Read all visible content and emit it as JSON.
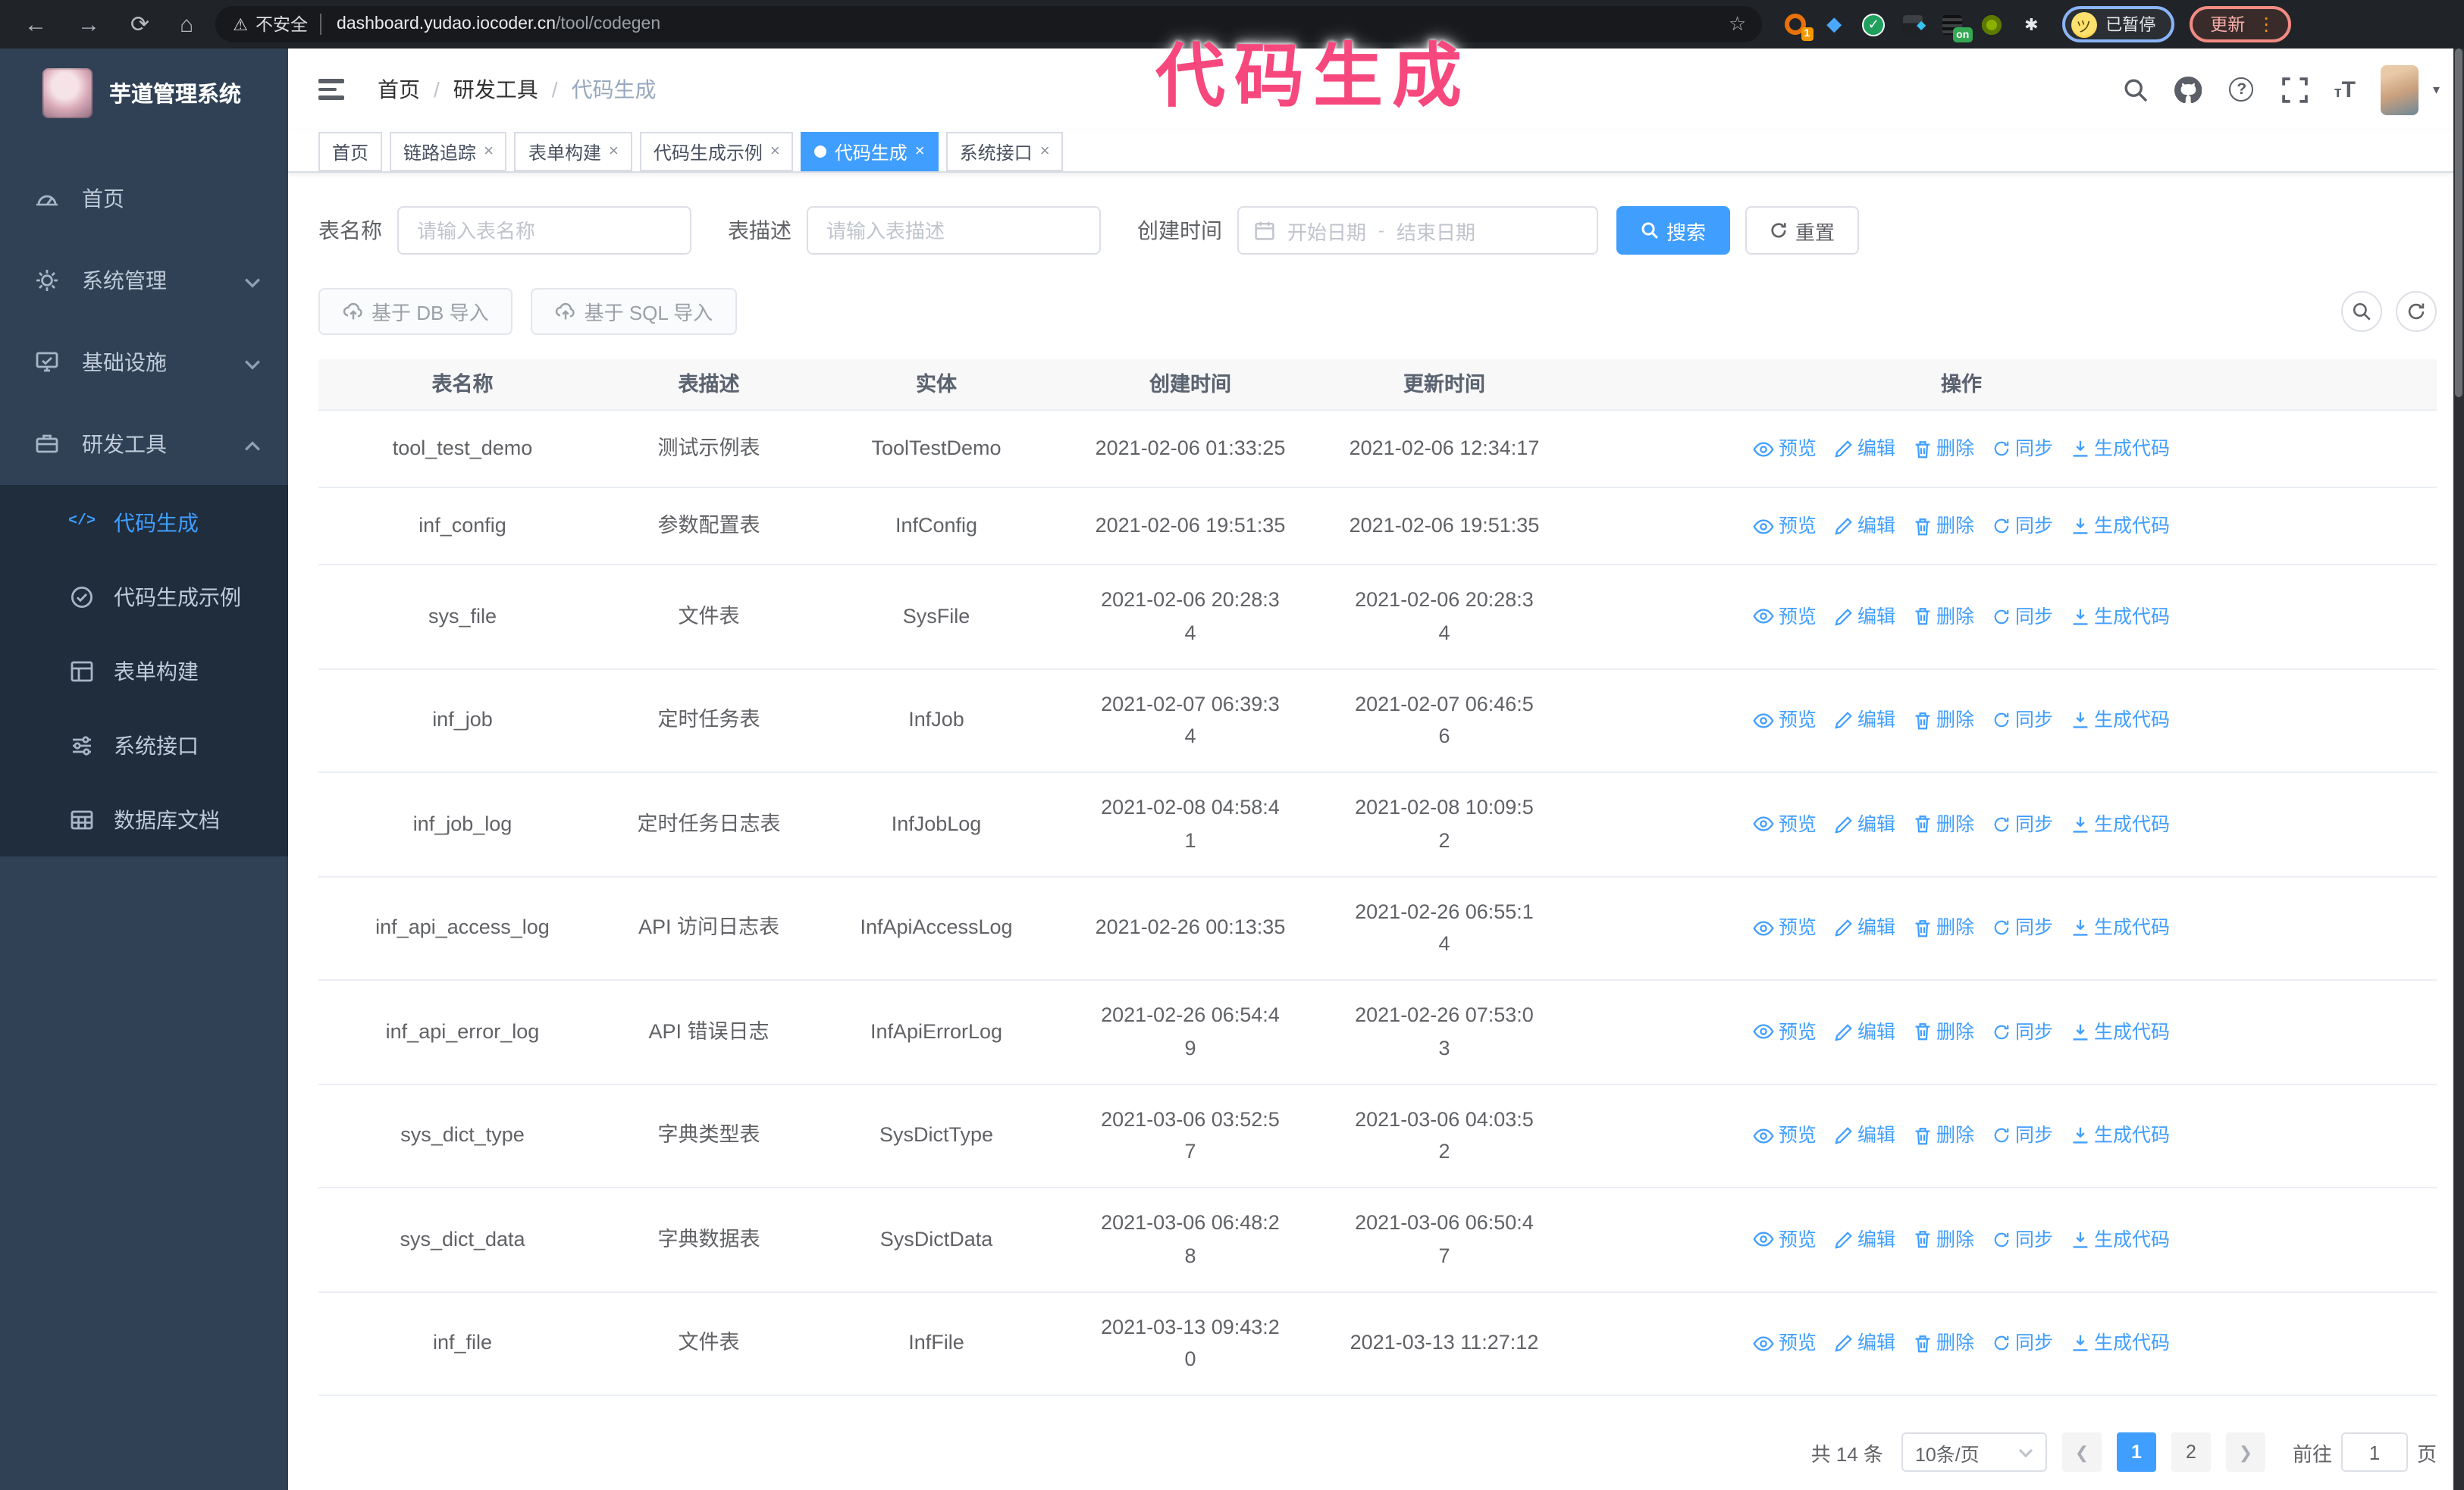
{
  "colors": {
    "accent": "#409eff",
    "annotation_pink": "#f7487e",
    "sidebar_bg": "#304156",
    "submenu_bg": "#1f2d3d",
    "chrome_bg": "#202327"
  },
  "icons": {
    "back": "←",
    "forward": "→",
    "reload": "⟳",
    "home": "⌂",
    "warning": "⚠",
    "star": "☆",
    "check": "✓",
    "gem": "◆",
    "grid_gem": "◆",
    "puzzle": "✱",
    "dots": "⋮",
    "caret_down": "▾",
    "close": "×",
    "question": "?",
    "font_big": "T",
    "font_small": "т",
    "range_separator": "-",
    "slash": "/"
  },
  "browser": {
    "security_label": "不安全",
    "url_host": "dashboard.yudao.iocoder.cn",
    "url_path": "/tool/codegen",
    "extension_badge_count": "1",
    "extension_badge_on": "on",
    "profile_label": "已暂停",
    "update_label": "更新"
  },
  "annotation": {
    "text": "代码生成"
  },
  "sidebar": {
    "logo_title": "芋道管理系统",
    "items": [
      {
        "label": "首页",
        "icon": "dashboard-icon",
        "chevron": ""
      },
      {
        "label": "系统管理",
        "icon": "gear-icon",
        "chevron": "down"
      },
      {
        "label": "基础设施",
        "icon": "infra-icon",
        "chevron": "down"
      },
      {
        "label": "研发工具",
        "icon": "tools-icon",
        "chevron": "up"
      }
    ],
    "sub_items": [
      {
        "label": "代码生成",
        "icon": "code-icon",
        "active": true
      },
      {
        "label": "代码生成示例",
        "icon": "example-icon",
        "active": false
      },
      {
        "label": "表单构建",
        "icon": "form-icon",
        "active": false
      },
      {
        "label": "系统接口",
        "icon": "api-icon",
        "active": false
      },
      {
        "label": "数据库文档",
        "icon": "database-icon",
        "active": false
      }
    ]
  },
  "header": {
    "breadcrumb": [
      "首页",
      "研发工具",
      "代码生成"
    ]
  },
  "tabs": [
    {
      "label": "首页",
      "closable": false,
      "active": false
    },
    {
      "label": "链路追踪",
      "closable": true,
      "active": false
    },
    {
      "label": "表单构建",
      "closable": true,
      "active": false
    },
    {
      "label": "代码生成示例",
      "closable": true,
      "active": false
    },
    {
      "label": "代码生成",
      "closable": true,
      "active": true
    },
    {
      "label": "系统接口",
      "closable": true,
      "active": false
    }
  ],
  "search": {
    "name_label": "表名称",
    "name_placeholder": "请输入表名称",
    "desc_label": "表描述",
    "desc_placeholder": "请输入表描述",
    "time_label": "创建时间",
    "start_placeholder": "开始日期",
    "end_placeholder": "结束日期",
    "search_label": "搜索",
    "reset_label": "重置"
  },
  "toolbar": {
    "import_db_label": "基于 DB 导入",
    "import_sql_label": "基于 SQL 导入"
  },
  "table": {
    "columns": [
      "表名称",
      "表描述",
      "实体",
      "创建时间",
      "更新时间",
      "操作"
    ],
    "action_labels": [
      "预览",
      "编辑",
      "删除",
      "同步",
      "生成代码"
    ],
    "rows": [
      {
        "name": "tool_test_demo",
        "desc": "测试示例表",
        "entity": "ToolTestDemo",
        "created": "2021-02-06 01:33:25",
        "updated": "2021-02-06 12:34:17"
      },
      {
        "name": "inf_config",
        "desc": "参数配置表",
        "entity": "InfConfig",
        "created": "2021-02-06 19:51:35",
        "updated": "2021-02-06 19:51:35"
      },
      {
        "name": "sys_file",
        "desc": "文件表",
        "entity": "SysFile",
        "created": "2021-02-06 20:28:3\n4",
        "updated": "2021-02-06 20:28:3\n4"
      },
      {
        "name": "inf_job",
        "desc": "定时任务表",
        "entity": "InfJob",
        "created": "2021-02-07 06:39:3\n4",
        "updated": "2021-02-07 06:46:5\n6"
      },
      {
        "name": "inf_job_log",
        "desc": "定时任务日志表",
        "entity": "InfJobLog",
        "created": "2021-02-08 04:58:4\n1",
        "updated": "2021-02-08 10:09:5\n2"
      },
      {
        "name": "inf_api_access_log",
        "desc": "API 访问日志表",
        "entity": "InfApiAccessLog",
        "created": "2021-02-26 00:13:35",
        "updated": "2021-02-26 06:55:1\n4"
      },
      {
        "name": "inf_api_error_log",
        "desc": "API 错误日志",
        "entity": "InfApiErrorLog",
        "created": "2021-02-26 06:54:4\n9",
        "updated": "2021-02-26 07:53:0\n3"
      },
      {
        "name": "sys_dict_type",
        "desc": "字典类型表",
        "entity": "SysDictType",
        "created": "2021-03-06 03:52:5\n7",
        "updated": "2021-03-06 04:03:5\n2"
      },
      {
        "name": "sys_dict_data",
        "desc": "字典数据表",
        "entity": "SysDictData",
        "created": "2021-03-06 06:48:2\n8",
        "updated": "2021-03-06 06:50:4\n7"
      },
      {
        "name": "inf_file",
        "desc": "文件表",
        "entity": "InfFile",
        "created": "2021-03-13 09:43:2\n0",
        "updated": "2021-03-13 11:27:12"
      }
    ]
  },
  "pagination": {
    "total_label": "共 14 条",
    "page_size_label": "10条/页",
    "pages": [
      "1",
      "2"
    ],
    "active_page": "1",
    "goto_label": "前往",
    "goto_value": "1",
    "page_unit": "页"
  }
}
